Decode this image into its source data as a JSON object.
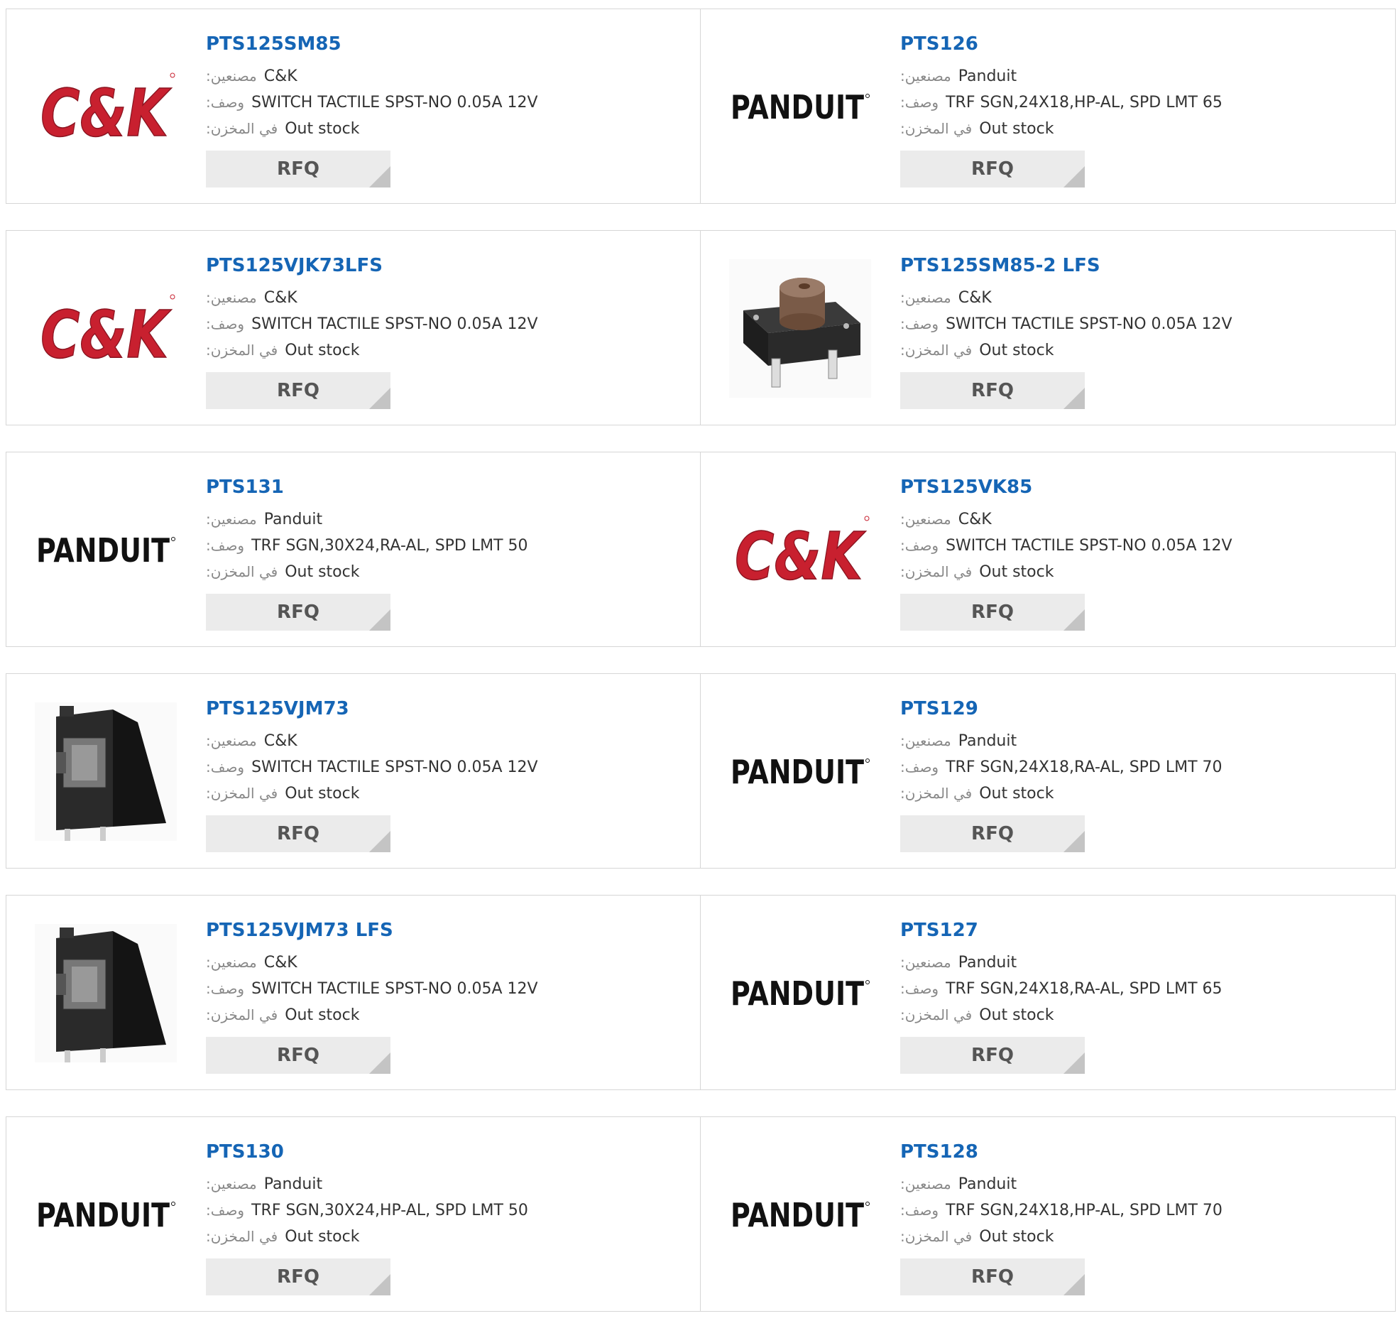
{
  "labels": {
    "manufacturer": ":مصنعين",
    "description": ":وصف",
    "stock": ":في المخزن",
    "rfq": "RFQ"
  },
  "logos": {
    "ck_text": "C&K",
    "panduit_text": "PANDUIT"
  },
  "colors": {
    "link": "#1565b5",
    "ck_red": "#c8202f",
    "button_bg": "#ebebeb"
  },
  "products": [
    {
      "pn": "PTS125SM85",
      "manufacturer": "C&K",
      "description": "SWITCH TACTILE SPST-NO 0.05A 12V",
      "stock": "Out stock",
      "image": "ck-logo"
    },
    {
      "pn": "PTS126",
      "manufacturer": "Panduit",
      "description": "TRF SGN,24X18,HP-AL, SPD LMT 65",
      "stock": "Out stock",
      "image": "panduit-logo"
    },
    {
      "pn": "PTS125VJK73LFS",
      "manufacturer": "C&K",
      "description": "SWITCH TACTILE SPST-NO 0.05A 12V",
      "stock": "Out stock",
      "image": "ck-logo"
    },
    {
      "pn": "PTS125SM85-2 LFS",
      "manufacturer": "C&K",
      "description": "SWITCH TACTILE SPST-NO 0.05A 12V",
      "stock": "Out stock",
      "image": "tactile-switch-photo"
    },
    {
      "pn": "PTS131",
      "manufacturer": "Panduit",
      "description": "TRF SGN,30X24,RA-AL, SPD LMT 50",
      "stock": "Out stock",
      "image": "panduit-logo"
    },
    {
      "pn": "PTS125VK85",
      "manufacturer": "C&K",
      "description": "SWITCH TACTILE SPST-NO 0.05A 12V",
      "stock": "Out stock",
      "image": "ck-logo"
    },
    {
      "pn": "PTS125VJM73",
      "manufacturer": "C&K",
      "description": "SWITCH TACTILE SPST-NO 0.05A 12V",
      "stock": "Out stock",
      "image": "side-switch-photo"
    },
    {
      "pn": "PTS129",
      "manufacturer": "Panduit",
      "description": "TRF SGN,24X18,RA-AL, SPD LMT 70",
      "stock": "Out stock",
      "image": "panduit-logo"
    },
    {
      "pn": "PTS125VJM73 LFS",
      "manufacturer": "C&K",
      "description": "SWITCH TACTILE SPST-NO 0.05A 12V",
      "stock": "Out stock",
      "image": "side-switch-photo"
    },
    {
      "pn": "PTS127",
      "manufacturer": "Panduit",
      "description": "TRF SGN,24X18,RA-AL, SPD LMT 65",
      "stock": "Out stock",
      "image": "panduit-logo"
    },
    {
      "pn": "PTS130",
      "manufacturer": "Panduit",
      "description": "TRF SGN,30X24,HP-AL, SPD LMT 50",
      "stock": "Out stock",
      "image": "panduit-logo"
    },
    {
      "pn": "PTS128",
      "manufacturer": "Panduit",
      "description": "TRF SGN,24X18,HP-AL, SPD LMT 70",
      "stock": "Out stock",
      "image": "panduit-logo"
    }
  ]
}
